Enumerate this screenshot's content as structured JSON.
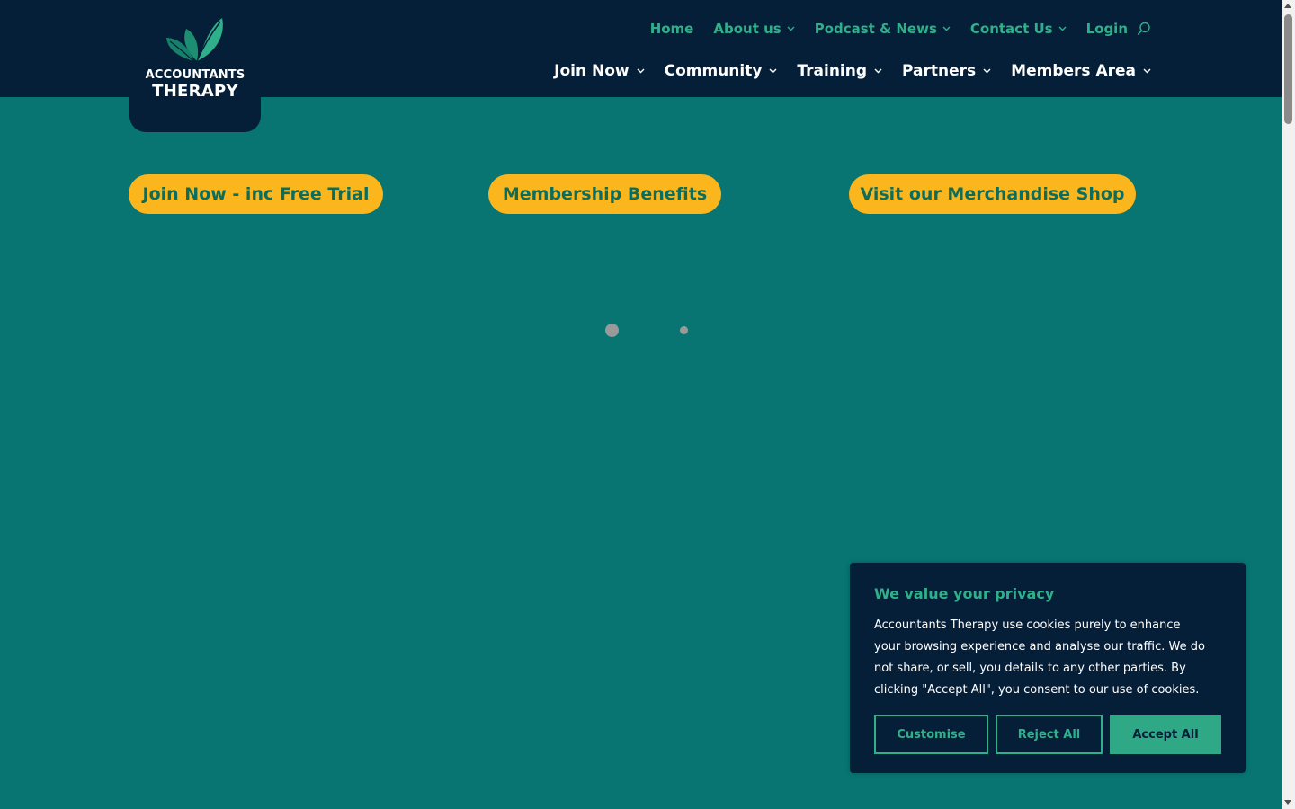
{
  "brand": {
    "line1": "ACCOUNTANTS",
    "line2": "THERAPY",
    "logo_icon": "leaf-icon",
    "colors": {
      "header_bg": "#051f38",
      "page_bg": "#087572",
      "accent_green": "#2fb08a",
      "cta_yellow": "#fcb61d"
    }
  },
  "top_nav": {
    "items": [
      {
        "label": "Home",
        "dropdown": false
      },
      {
        "label": "About us",
        "dropdown": true
      },
      {
        "label": "Podcast & News",
        "dropdown": true
      },
      {
        "label": "Contact Us",
        "dropdown": true
      },
      {
        "label": "Login",
        "dropdown": false
      }
    ],
    "search_icon": "search-icon"
  },
  "main_nav": {
    "items": [
      {
        "label": "Join Now",
        "dropdown": true
      },
      {
        "label": "Community",
        "dropdown": true
      },
      {
        "label": "Training",
        "dropdown": true
      },
      {
        "label": "Partners",
        "dropdown": true
      },
      {
        "label": "Members Area",
        "dropdown": true
      }
    ]
  },
  "cta": {
    "join": "Join Now - inc Free Trial",
    "benefits": "Membership Benefits",
    "shop": "Visit our Merchandise Shop"
  },
  "cookie": {
    "title": "We value your privacy",
    "text": "Accountants Therapy use cookies purely to enhance your browsing experience and analyse our traffic. We do not share, or sell, you details to any other parties. By clicking \"Accept All\", you consent to our use of cookies.",
    "customise": "Customise",
    "reject": "Reject All",
    "accept": "Accept All"
  }
}
